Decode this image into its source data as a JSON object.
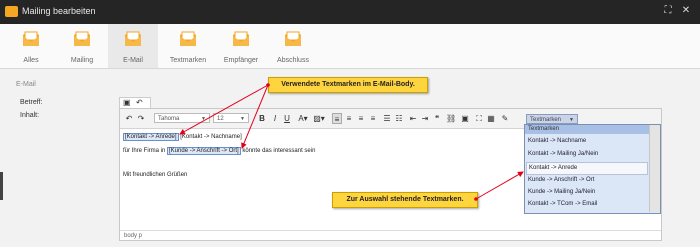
{
  "window": {
    "title": "Mailing bearbeiten",
    "fullscreen_icon": "fullscreen-icon",
    "close_icon": "close-icon"
  },
  "tabs": [
    {
      "label": "Alles",
      "active": false
    },
    {
      "label": "Mailing",
      "active": false
    },
    {
      "label": "E-Mail",
      "active": true
    },
    {
      "label": "Textmarken",
      "active": false
    },
    {
      "label": "Empfänger",
      "active": false
    },
    {
      "label": "Abschluss",
      "active": false
    }
  ],
  "section_title": "E-Mail",
  "form": {
    "subject_label": "Betreff:",
    "content_label": "Inhalt:"
  },
  "toolbar": {
    "font": "Tahoma",
    "size": "12",
    "textmarken_select": "Textmarken"
  },
  "content": {
    "line1": {
      "tm1": "[Kontakt -> Anrede]",
      "tm2": "[Kontakt -> Nachname]"
    },
    "line2": {
      "before": "für Ihre Firma in ",
      "tm": "[Kunde -> Anschrift -> Ort]",
      "after": " könnte das interessant sein"
    },
    "line3": "Mit freundlichen Grüßen"
  },
  "statusbar": "body  p",
  "dropdown": {
    "header": "Textmarken",
    "items": [
      "Kontakt -> Nachname",
      "Kontakt -> Mailing Ja/Nein",
      "Kontakt -> Anrede",
      "Kunde -> Anschrift -> Ort",
      "Kunde -> Mailing Ja/Nein",
      "Kontakt -> TCom -> Email"
    ],
    "selected_index": 2
  },
  "callouts": {
    "top": "Verwendete Textmarken im E-Mail-Body.",
    "bottom": "Zur Auswahl stehende Textmarken."
  },
  "colors": {
    "accent": "#f5a623",
    "titlebar": "#252525",
    "callout": "#ffd53f",
    "arrow": "#e3001b"
  }
}
